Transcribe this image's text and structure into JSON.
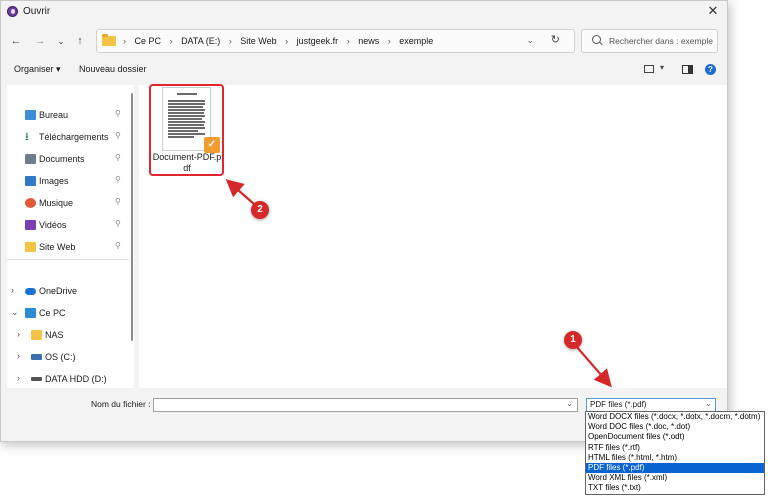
{
  "window": {
    "title": "Ouvrir"
  },
  "nav": {
    "back": "←",
    "forward": "→",
    "recent": "⌄",
    "up": "↑"
  },
  "address": {
    "breadcrumbs": [
      "Ce PC",
      "DATA (E:)",
      "Site Web",
      "justgeek.fr",
      "news",
      "exemple"
    ],
    "dropdown": "⌄",
    "refresh": "↻"
  },
  "search": {
    "placeholder": "Rechercher dans : exemple"
  },
  "toolbar": {
    "organize": "Organiser ▾",
    "new_folder": "Nouveau dossier",
    "view_dropdown": "▾",
    "help": "?"
  },
  "sidebar": {
    "quick_access": [
      {
        "label": "Bureau",
        "icon": "desktop-icon",
        "color": "#3b8fd9"
      },
      {
        "label": "Téléchargements",
        "icon": "download-icon",
        "color": "#1f7a3f"
      },
      {
        "label": "Documents",
        "icon": "documents-icon",
        "color": "#6f7d8c"
      },
      {
        "label": "Images",
        "icon": "images-icon",
        "color": "#2f79c9"
      },
      {
        "label": "Musique",
        "icon": "music-icon",
        "color": "#e05a3a"
      },
      {
        "label": "Vidéos",
        "icon": "videos-icon",
        "color": "#7b3fb5"
      },
      {
        "label": "Site Web",
        "icon": "folder-icon",
        "color": "#f4c245"
      }
    ],
    "pin_glyph": "📌",
    "tree": [
      {
        "label": "OneDrive",
        "chevron": "›",
        "icon": "onedrive-icon",
        "color": "#1c72d6"
      },
      {
        "label": "Ce PC",
        "chevron": "⌄",
        "icon": "pc-icon",
        "color": "#2a8bd6"
      },
      {
        "label": "NAS",
        "chevron": "›",
        "icon": "folder-icon",
        "color": "#f4c245"
      },
      {
        "label": "OS (C:)",
        "chevron": "›",
        "icon": "drive-c-icon",
        "color": "#3a6fb0"
      },
      {
        "label": "DATA HDD (D:)",
        "chevron": "›",
        "icon": "hdd-icon",
        "color": "#555555"
      }
    ]
  },
  "files": [
    {
      "name": "Document-PDF.pdf",
      "badge": "✓"
    }
  ],
  "bottom": {
    "filename_label": "Nom du fichier :",
    "filename_value": "",
    "filename_dropdown": "⌄",
    "filetype_selected": "PDF files (*.pdf)",
    "filetype_dropdown": "⌄",
    "filetype_options": [
      "Word DOCX files (*.docx, *.dotx, *.docm, *.dotm)",
      "Word DOC files (*.doc, *.dot)",
      "OpenDocument files (*.odt)",
      "RTF files (*.rtf)",
      "HTML files (*.html, *.htm)",
      "PDF files (*.pdf)",
      "Word XML files (*.xml)",
      "TXT files (*.txt)"
    ],
    "selected_index": 5
  },
  "annotations": [
    {
      "label": "1"
    },
    {
      "label": "2"
    }
  ],
  "colors": {
    "accent": "#0a64d2",
    "annotation": "#d62828",
    "selection_border": "#e0262e"
  }
}
